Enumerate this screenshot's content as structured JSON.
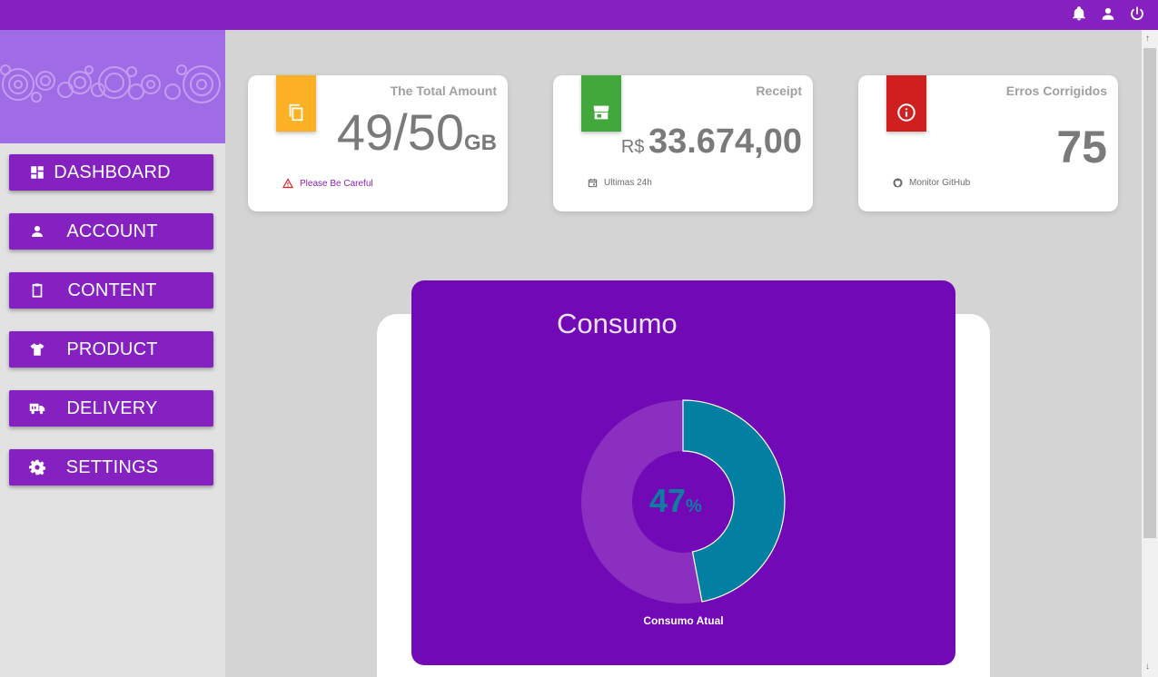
{
  "menu": [
    {
      "label": "DASHBOARD",
      "icon": "dashboard-icon"
    },
    {
      "label": "ACCOUNT",
      "icon": "person-icon"
    },
    {
      "label": "CONTENT",
      "icon": "clipboard-icon"
    },
    {
      "label": "PRODUCT",
      "icon": "shirt-icon"
    },
    {
      "label": "DELIVERY",
      "icon": "truck-icon"
    },
    {
      "label": "SETTINGS",
      "icon": "gear-icon"
    }
  ],
  "cards": {
    "total": {
      "title": "The Total Amount",
      "value": "49/50",
      "unit": "GB",
      "footer": "Please Be Careful",
      "color": "#fbb123",
      "icon": "copy-icon",
      "footer_icon": "warning-icon"
    },
    "receipt": {
      "title": "Receipt",
      "currency": "R$",
      "value": "33.674,00",
      "footer": "Ultimas 24h",
      "color": "#43a83b",
      "icon": "store-icon",
      "footer_icon": "calendar-icon"
    },
    "errors": {
      "title": "Erros Corrigidos",
      "value": "75",
      "footer": "Monitor GitHub",
      "color": "#d01f1f",
      "icon": "info-icon",
      "footer_icon": "github-icon"
    }
  },
  "chart_data": {
    "type": "pie",
    "title": "Consumo",
    "center_value": "47",
    "center_unit": "%",
    "slices": [
      {
        "name": "Consumo Atual",
        "value": 47,
        "color": "#027fa1"
      },
      {
        "name": "",
        "value": 53,
        "color": "#8a2fc0"
      }
    ],
    "legend_label": "Consumo Atual"
  },
  "colors": {
    "accent": "#8421c0",
    "panel": "#7209b7"
  }
}
